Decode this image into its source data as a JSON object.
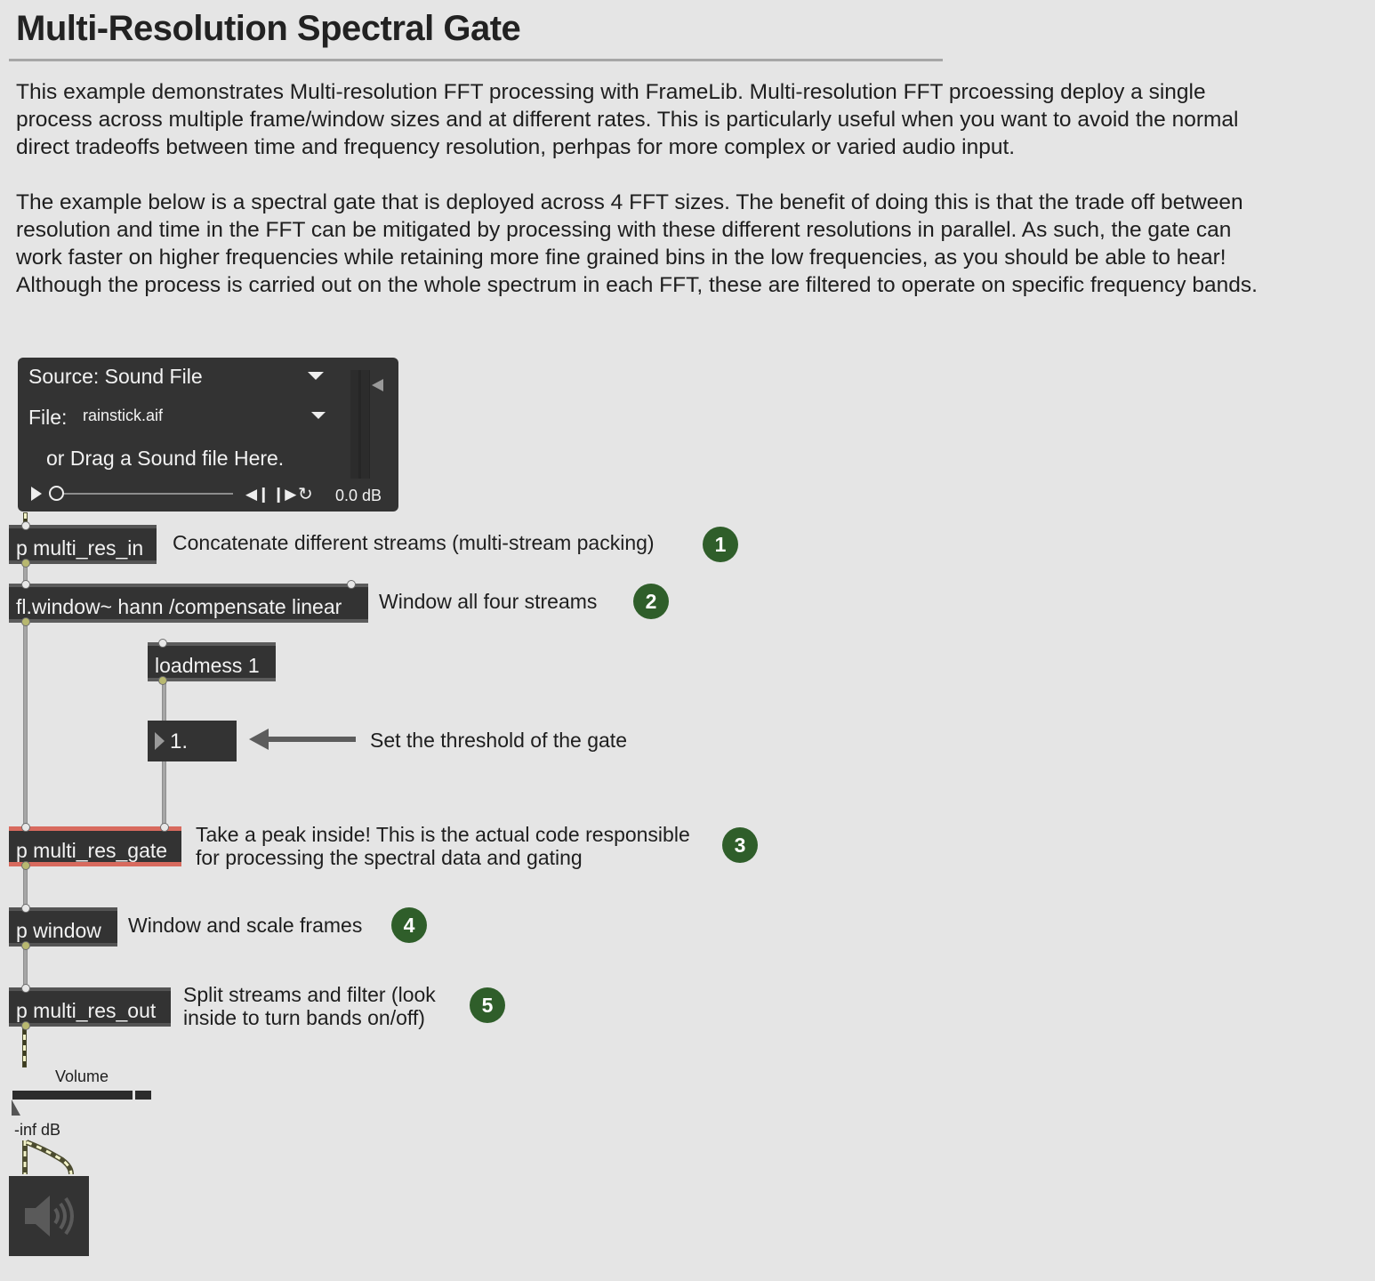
{
  "header": {
    "title": "Multi-Resolution Spectral Gate"
  },
  "description": {
    "paragraph1": "This example demonstrates Multi-resolution FFT processing with FrameLib. Multi-resolution FFT prcoessing deploy a single process across multiple frame/window sizes and at different rates. This is particularly useful when you want to avoid the normal direct tradeoffs between time and frequency resolution, perhpas for more complex or varied audio input.",
    "paragraph2": "The example below is a spectral gate that is deployed across 4 FFT sizes. The benefit of doing this is that the trade off between resolution and time in the FFT can be mitigated by processing with these different resolutions in parallel. As such, the gate can work faster on higher frequencies while retaining more fine grained bins in the low frequencies, as you should be able to hear! Although the process is carried out on the whole spectrum in each FFT, these are filtered to operate on specific frequency bands."
  },
  "source_panel": {
    "source_label": "Source: Sound File",
    "file_label": "File:",
    "file_name": "rainstick.aif",
    "drag_hint": "or Drag a Sound file Here.",
    "gain_readout": "0.0 dB",
    "icons": [
      "dropdown-caret-icon",
      "play-icon",
      "previous-icon",
      "next-icon",
      "loop-icon",
      "gain-arrow-icon"
    ]
  },
  "patch": {
    "multi_res_in": {
      "label": "p multi_res_in",
      "comment": "Concatenate different streams (multi-stream packing)",
      "step": "1"
    },
    "window": {
      "label": "fl.window~ hann /compensate linear",
      "comment": "Window all four streams",
      "step": "2"
    },
    "loadmess": {
      "label": "loadmess 1"
    },
    "threshold": {
      "value": "1.",
      "comment": "Set the threshold of the gate"
    },
    "multi_res_gate": {
      "label": "p multi_res_gate",
      "comment_line1": "Take a peak inside! This is the actual code responsible",
      "comment_line2": "for processing the spectral data and gating",
      "step": "3"
    },
    "p_window": {
      "label": "p window",
      "comment": "Window and scale frames",
      "step": "4"
    },
    "multi_res_out": {
      "label": "p multi_res_out",
      "comment_line1": "Split streams and filter (look",
      "comment_line2": "inside to turn bands on/off)",
      "step": "5"
    }
  },
  "output": {
    "volume_label": "Volume",
    "gain_db": "-inf dB",
    "dac_icon": "speaker-icon"
  },
  "colors": {
    "background": "#e5e5e5",
    "object_bg": "#333333",
    "badge_green": "#2f5e2a",
    "highlight_red": "#d86a5e"
  }
}
